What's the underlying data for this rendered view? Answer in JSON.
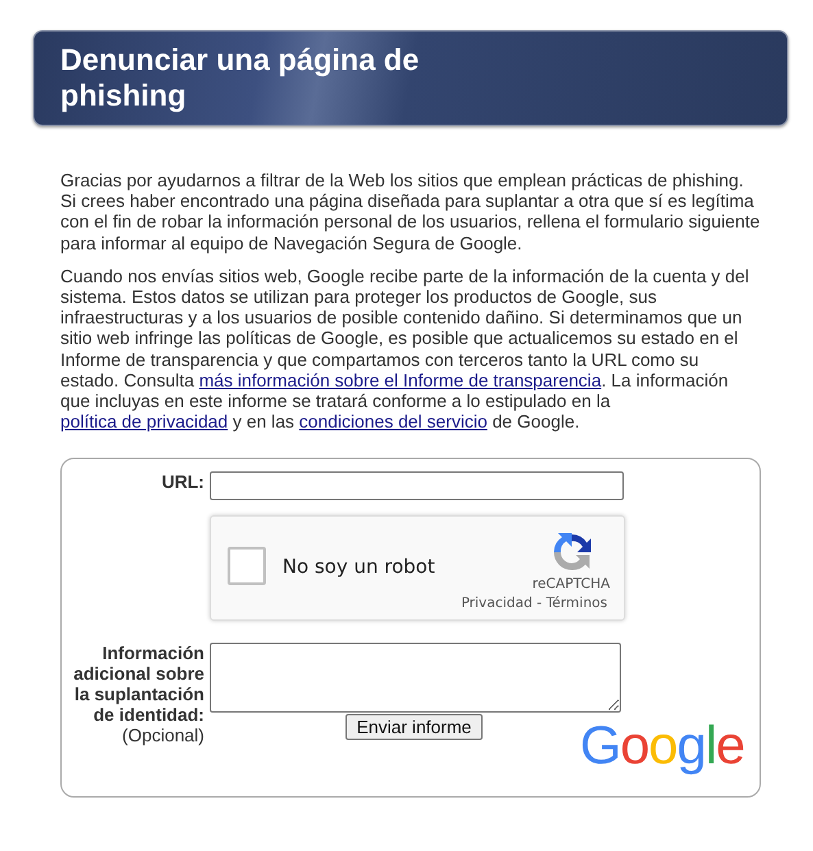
{
  "header": {
    "title": "Denunciar una página de phishing"
  },
  "intro": "Gracias por ayudarnos a filtrar de la Web los sitios que emplean prácticas de phishing. Si crees haber encontrado una página diseñada para suplantar a otra que sí es legítima con el fin de robar la información personal de los usuarios, rellena el formulario siguiente para informar al equipo de Navegación Segura de Google.",
  "notice": [
    {
      "kind": "text",
      "text": "Cuando nos envías sitios web, Google recibe parte de la información de la cuenta y del sistema. Estos datos se utilizan para proteger los productos de Google, sus infraestructuras y a los usuarios de posible contenido dañino. Si determinamos que un sitio web infringe las políticas de Google, es posible que actualicemos su estado en el Informe de transparencia y que compartamos con terceros tanto la URL como su estado. Consulta "
    },
    {
      "kind": "link",
      "text": "más información sobre el Informe de transparencia"
    },
    {
      "kind": "text",
      "text": ". La información que incluyas en este informe se tratará conforme a lo estipulado en la "
    },
    {
      "kind": "link",
      "text": "política de privacidad"
    },
    {
      "kind": "text",
      "text": " y en las "
    },
    {
      "kind": "link",
      "text": "condiciones del servicio"
    },
    {
      "kind": "text",
      "text": " de Google."
    }
  ],
  "form": {
    "url_label": "URL:",
    "captcha": {
      "label": "No soy un robot",
      "checked": false,
      "brand": "reCAPTCHA",
      "privacy": "Privacidad",
      "separator": "-",
      "terms": "Términos"
    },
    "details_label": "Información adicional sobre la suplantación de identidad:",
    "details_hint": "(Opcional)",
    "submit": "Enviar informe",
    "logo": "Google"
  }
}
